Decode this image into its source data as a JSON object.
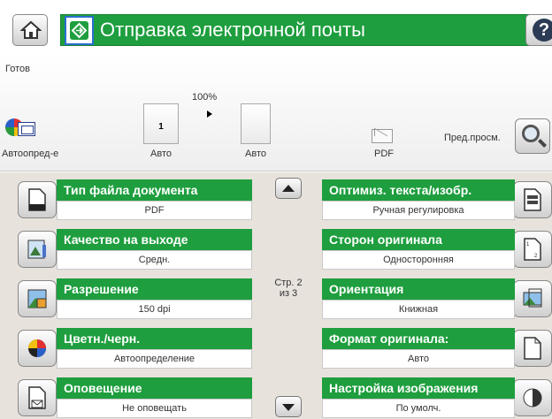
{
  "header": {
    "title": "Отправка электронной почты",
    "help_label": "?"
  },
  "status": {
    "text": "Готов",
    "zoom": "100%",
    "page_number": "1",
    "auto_detect_label": "Автоопред-е",
    "thumb1_label": "Авто",
    "thumb2_label": "Авто",
    "file_type_label": "PDF",
    "preview_label": "Пред.просм."
  },
  "options": {
    "left": [
      {
        "title": "Тип файла документа",
        "value": "PDF",
        "icon": "document-icon"
      },
      {
        "title": "Качество на выходе",
        "value": "Средн.",
        "icon": "quality-icon"
      },
      {
        "title": "Разрешение",
        "value": "150 dpi",
        "icon": "resolution-icon"
      },
      {
        "title": "Цветн./черн.",
        "value": "Автоопределение",
        "icon": "color-icon"
      },
      {
        "title": "Оповещение",
        "value": "Не оповещать",
        "icon": "notification-icon"
      }
    ],
    "right": [
      {
        "title": "Оптимиз. текста/изобр.",
        "value": "Ручная регулировка",
        "icon": "optimize-icon"
      },
      {
        "title": "Сторон оригинала",
        "value": "Односторонняя",
        "icon": "sides-icon"
      },
      {
        "title": "Ориентация",
        "value": "Книжная",
        "icon": "orientation-icon"
      },
      {
        "title": "Формат оригинала:",
        "value": "Авто",
        "icon": "original-size-icon"
      },
      {
        "title": "Настройка изображения",
        "value": "По умолч.",
        "icon": "image-adjust-icon"
      }
    ]
  },
  "pagination": {
    "line1": "Стр. 2",
    "line2": "из 3"
  },
  "colors": {
    "accent_green": "#1e9e3e",
    "panel_bg": "#e8e2dd"
  }
}
